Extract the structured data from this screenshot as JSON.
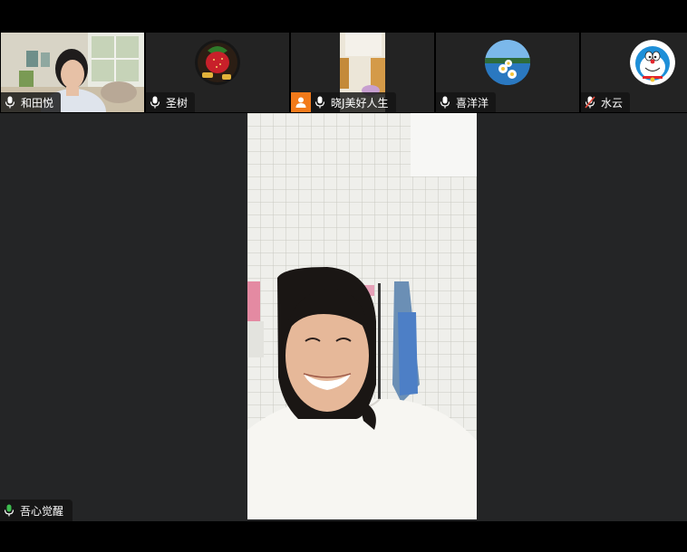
{
  "participants_strip": [
    {
      "name": "和田悦",
      "mic": "on",
      "tile": "video"
    },
    {
      "name": "圣树",
      "mic": "on",
      "tile": "avatar",
      "avatar_icon": "strawberry-avatar-icon"
    },
    {
      "name": "晓J美好人生",
      "mic": "on",
      "tile": "video",
      "badge_icon": "person-icon",
      "badge_color": "#f27a1a"
    },
    {
      "name": "喜洋洋",
      "mic": "on",
      "tile": "avatar",
      "avatar_icon": "lake-daisy-avatar-icon"
    },
    {
      "name": "水云",
      "mic": "muted",
      "tile": "avatar",
      "avatar_icon": "doraemon-avatar-icon"
    }
  ],
  "main_speaker": {
    "name": "吾心觉醒",
    "mic": "active",
    "mic_color": "#3dbd4f"
  },
  "colors": {
    "tile_bg": "#232323",
    "main_bg": "#242526",
    "muted_red": "#e5493a",
    "active_green": "#3dbd4f"
  }
}
